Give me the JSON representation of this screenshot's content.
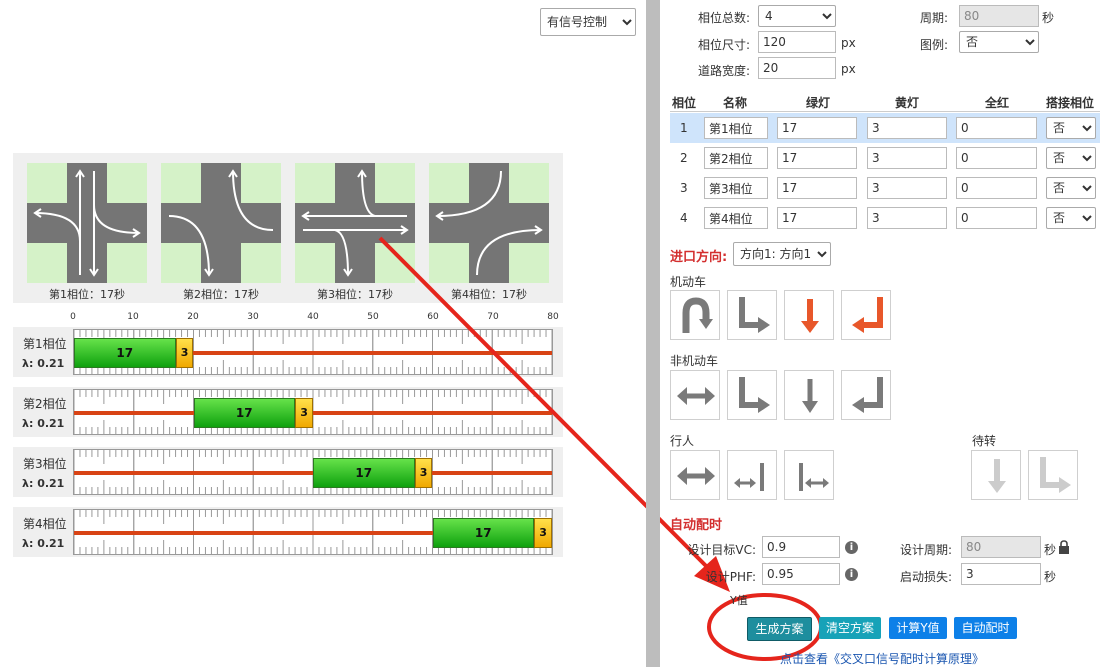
{
  "control_select": "有信号控制",
  "phases": [
    {
      "caption": "第1相位：17秒"
    },
    {
      "caption": "第2相位：17秒"
    },
    {
      "caption": "第3相位：17秒"
    },
    {
      "caption": "第4相位：17秒"
    }
  ],
  "timeline": {
    "scale_ticks": [
      "0",
      "10",
      "20",
      "30",
      "40",
      "50",
      "60",
      "70",
      "80"
    ],
    "cycle": 80,
    "rows": [
      {
        "name": "第1相位",
        "lambda": "λ: 0.21",
        "green": 17,
        "yellow": 3,
        "start": 0,
        "green_label": "17",
        "yellow_label": "3"
      },
      {
        "name": "第2相位",
        "lambda": "λ: 0.21",
        "green": 17,
        "yellow": 3,
        "start": 20,
        "green_label": "17",
        "yellow_label": "3"
      },
      {
        "name": "第3相位",
        "lambda": "λ: 0.21",
        "green": 17,
        "yellow": 3,
        "start": 40,
        "green_label": "17",
        "yellow_label": "3"
      },
      {
        "name": "第4相位",
        "lambda": "λ: 0.21",
        "green": 17,
        "yellow": 3,
        "start": 60,
        "green_label": "17",
        "yellow_label": "3"
      }
    ]
  },
  "settings": {
    "phase_count_label": "相位总数:",
    "phase_count": "4",
    "cycle_label": "周期:",
    "cycle_value": "80",
    "cycle_unit": "秒",
    "phase_size_label": "相位尺寸:",
    "phase_size": "120",
    "px_unit": "px",
    "legend_label": "图例:",
    "legend_value": "否",
    "road_width_label": "道路宽度:",
    "road_width": "20"
  },
  "phase_table": {
    "headers": [
      "相位",
      "名称",
      "绿灯",
      "黄灯",
      "全红",
      "搭接相位"
    ],
    "rows": [
      {
        "idx": "1",
        "name": "第1相位",
        "green": "17",
        "yellow": "3",
        "red": "0",
        "overlap": "否"
      },
      {
        "idx": "2",
        "name": "第2相位",
        "green": "17",
        "yellow": "3",
        "red": "0",
        "overlap": "否"
      },
      {
        "idx": "3",
        "name": "第3相位",
        "green": "17",
        "yellow": "3",
        "red": "0",
        "overlap": "否"
      },
      {
        "idx": "4",
        "name": "第4相位",
        "green": "17",
        "yellow": "3",
        "red": "0",
        "overlap": "否"
      }
    ]
  },
  "approach": {
    "label": "进口方向:",
    "value": "方向1: 方向1"
  },
  "sections": {
    "motor": "机动车",
    "nonmotor": "非机动车",
    "pedestrian": "行人",
    "waiting": "待转"
  },
  "colors": {
    "arrow_active": "#e8572a",
    "arrow_inactive": "#7a7a7a",
    "arrow_disabled": "#cccccc",
    "accent_red": "#d32f2f"
  },
  "auto_timing": {
    "title": "自动配时",
    "target_vc_label": "设计目标VC:",
    "target_vc": "0.9",
    "design_cycle_label": "设计周期:",
    "design_cycle": "80",
    "design_cycle_unit": "秒",
    "phf_label": "设计PHF:",
    "phf": "0.95",
    "startup_loss_label": "启动损失:",
    "startup_loss": "3",
    "startup_loss_unit": "秒",
    "y_label": "Y值"
  },
  "buttons": {
    "generate": "生成方案",
    "clear": "清空方案",
    "calc_y": "计算Y值",
    "auto": "自动配时"
  },
  "footer_link": "点击查看《交叉口信号配时计算原理》"
}
